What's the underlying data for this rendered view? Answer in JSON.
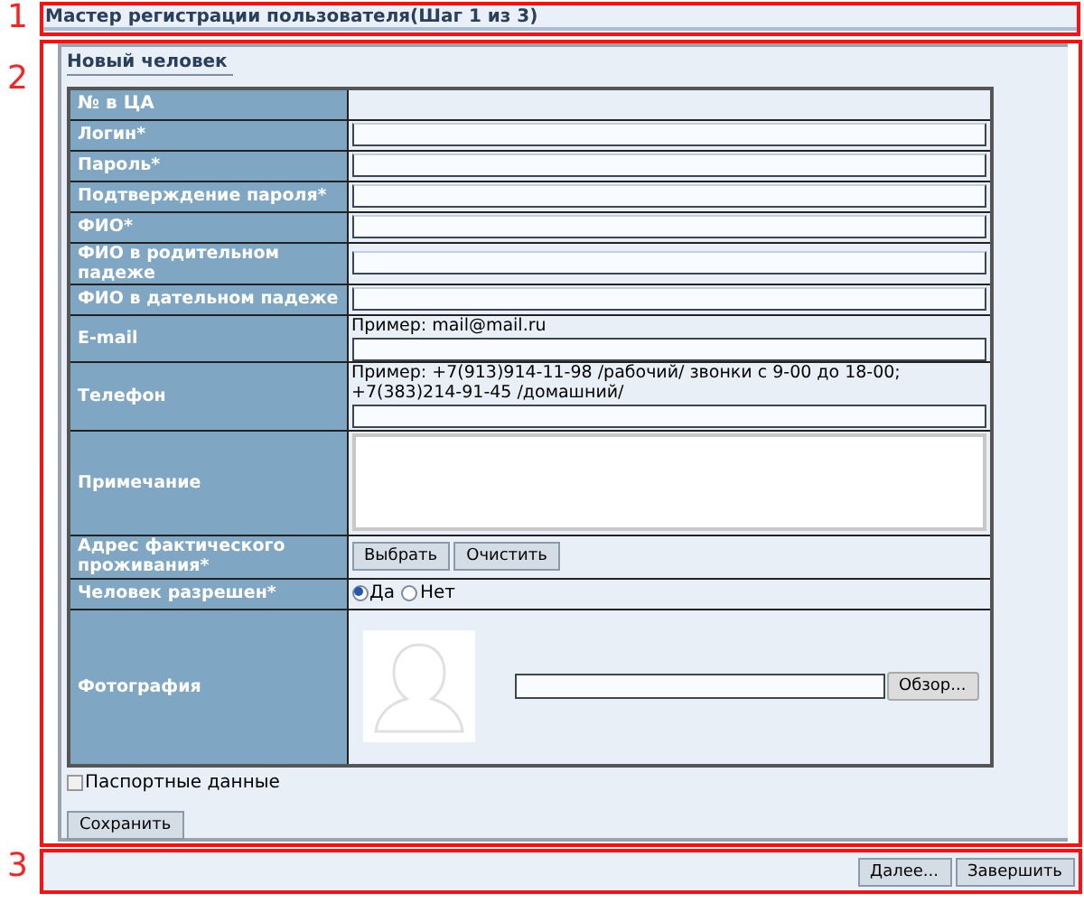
{
  "annotations": [
    "1",
    "2",
    "3"
  ],
  "wizard_title": "Мастер регистрации пользователя(Шаг 1 из 3)",
  "panel_title": "Новый человек",
  "form_rows": [
    {
      "kind": "empty",
      "label": "№ в ЦА"
    },
    {
      "kind": "input",
      "label": "Логин*"
    },
    {
      "kind": "input",
      "label": "Пароль*"
    },
    {
      "kind": "input",
      "label": "Подтверждение пароля*"
    },
    {
      "kind": "input",
      "label": "ФИО*"
    },
    {
      "kind": "input",
      "label": "ФИО в родительном падеже"
    },
    {
      "kind": "input",
      "label": "ФИО в дательном падеже"
    },
    {
      "kind": "hint_input",
      "label": "E-mail",
      "hint": "Пример: mail@mail.ru"
    },
    {
      "kind": "hint_input",
      "label": "Телефон",
      "hint": "Пример: +7(913)914-11-98 /рабочий/ звонки с 9-00 до 18-00; +7(383)214-91-45 /домашний/"
    },
    {
      "kind": "textarea",
      "label": "Примечание"
    },
    {
      "kind": "buttons",
      "label": "Адрес фактического проживания*",
      "buttons": [
        "Выбрать",
        "Очистить"
      ]
    },
    {
      "kind": "radio",
      "label": "Человек разрешен*",
      "options": [
        {
          "label": "Да",
          "selected": true
        },
        {
          "label": "Нет",
          "selected": false
        }
      ]
    },
    {
      "kind": "photo",
      "label": "Фотография",
      "browse": "Обзор..."
    }
  ],
  "passport_checkbox": {
    "label": "Паспортные данные",
    "checked": false
  },
  "save_button": "Сохранить",
  "footer_buttons": [
    "Далее...",
    "Завершить"
  ]
}
